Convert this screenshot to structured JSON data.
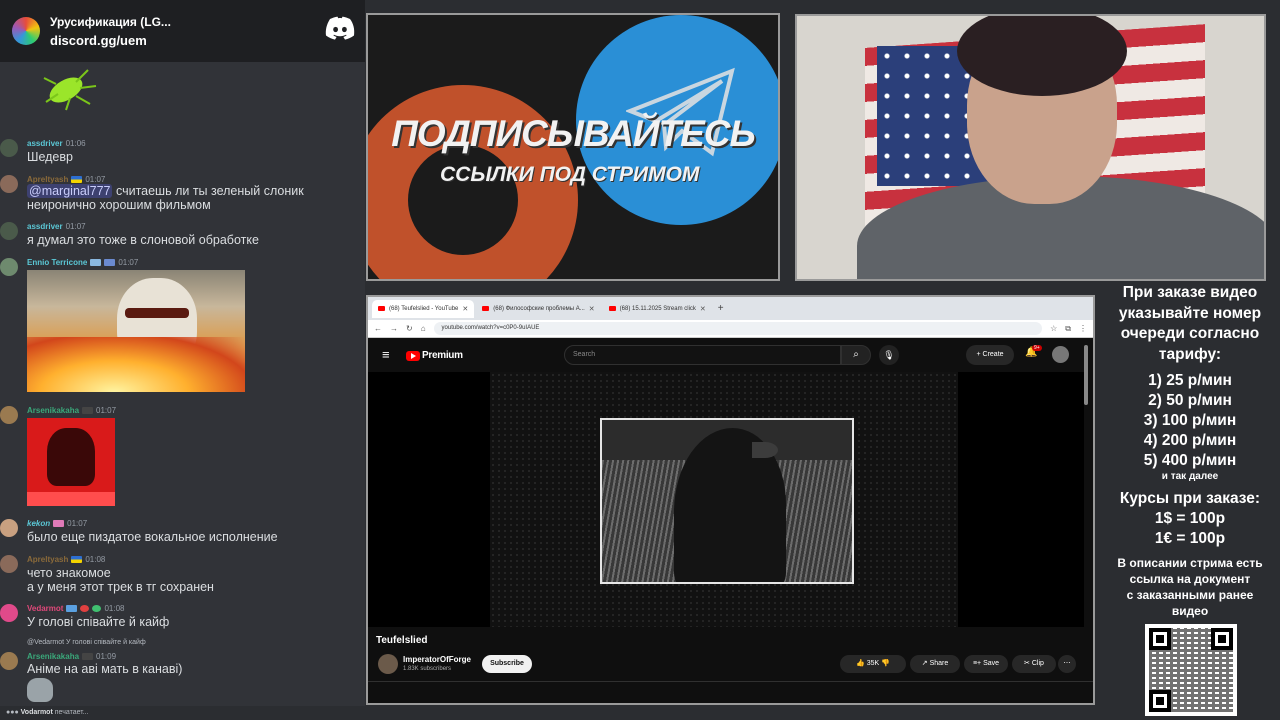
{
  "discord": {
    "server_name": "Урусификация (LG...",
    "server_link": "discord.gg/uem",
    "typing": "печатает...",
    "typing_user": "Vodarmot",
    "messages": [
      {
        "user": "assdriver",
        "user_color": "#5bc8d6",
        "time": "01:06",
        "lines": [
          "Шедевр"
        ]
      },
      {
        "user": "Apreltyash",
        "user_color": "#8a6a3a",
        "time": "01:07",
        "mention": "@marginal777",
        "lines": [
          "считаешь ли ты зеленый слоник",
          "неиронично хорошим фильмом"
        ]
      },
      {
        "user": "assdriver",
        "user_color": "#5bc8d6",
        "time": "01:07",
        "lines": [
          "я думал это тоже в слоновой обработке"
        ]
      },
      {
        "user": "Ennio Terricone",
        "user_color": "#5bc8d6",
        "time": "01:07",
        "lines": []
      },
      {
        "user": "Arsenikakaha",
        "user_color": "#3aa87a",
        "time": "01:07",
        "lines": []
      },
      {
        "user": "kekon",
        "user_color": "#5bc8d6",
        "time": "01:07",
        "lines": [
          "было еще пиздатое вокальное исполнение"
        ]
      },
      {
        "user": "Apreltyash",
        "user_color": "#8a6a3a",
        "time": "01:08",
        "lines": [
          "чето знакомое",
          "а у меня этот трек в тг сохранен"
        ]
      },
      {
        "user": "Vedarmot",
        "user_color": "#e0487a",
        "time": "01:08",
        "lines": [
          "У голові співайте й кайф"
        ]
      },
      {
        "user": "Arsenikakaha",
        "user_color": "#3aa87a",
        "time": "01:09",
        "reply": "@Vedarmot  У голові співайте й кайф",
        "lines": [
          "Аніме на аві мать в канаві)"
        ]
      }
    ]
  },
  "promo": {
    "title": "ПОДПИСЫВАЙТЕСЬ",
    "subtitle": "ССЫЛКИ ПОД СТРИМОМ"
  },
  "browser": {
    "tabs": [
      {
        "label": "(68) Teufelslied - YouTube",
        "active": true
      },
      {
        "label": "(68) Философские проблемы А...",
        "active": false
      },
      {
        "label": "(68) 15.11.2025 Stream click",
        "active": false
      }
    ],
    "url": "youtube.com/watch?v=c0P0-9uIAUE"
  },
  "youtube": {
    "brand": "Premium",
    "search_placeholder": "Search",
    "create_label": "Create",
    "notif_count": "9+",
    "video_title": "Teufelslied",
    "channel_name": "ImperatorOfForge",
    "subscribers": "1.83K subscribers",
    "subscribe_label": "Subscribe",
    "likes": "35K",
    "share_label": "Share",
    "save_label": "Save",
    "clip_label": "Clip"
  },
  "info": {
    "order_text": [
      "При заказе видео",
      "указывайте номер",
      "очереди согласно",
      "тарифу:"
    ],
    "rates": [
      "1) 25 р/мин",
      "2) 50 р/мин",
      "3) 100 р/мин",
      "4) 200 р/мин",
      "5) 400 р/мин"
    ],
    "etc": "и так далее",
    "courses_title": "Курсы при заказе:",
    "courses": [
      "1$ = 100р",
      "1€ = 100р"
    ],
    "doc_text": [
      "В описании стрима есть",
      "ссылка на документ",
      "с заказанными ранее",
      "видео"
    ]
  }
}
